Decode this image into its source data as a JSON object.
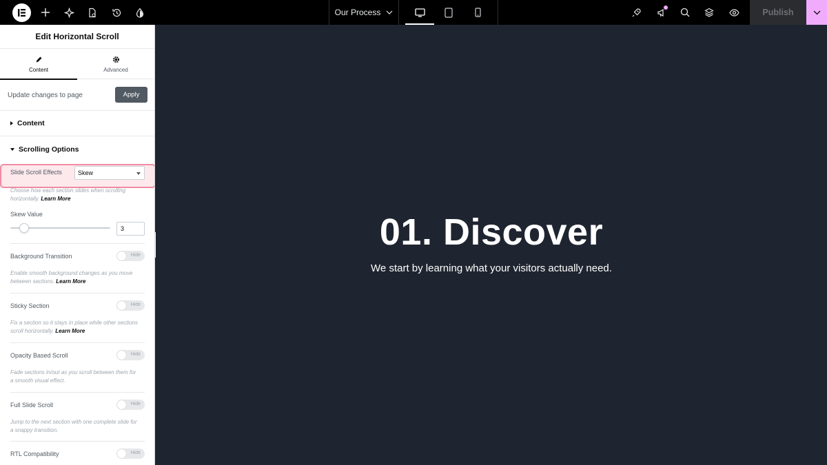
{
  "topbar": {
    "page_name": "Our Process",
    "publish_label": "Publish"
  },
  "panel": {
    "title": "Edit Horizontal Scroll",
    "tabs": [
      {
        "label": "Content",
        "icon": "pencil-icon",
        "active": true
      },
      {
        "label": "Advanced",
        "icon": "gear-icon",
        "active": false
      }
    ],
    "update_text": "Update changes to page",
    "apply_label": "Apply",
    "sections": {
      "content_label": "Content",
      "scrolling_label": "Scrolling Options"
    },
    "slide_scroll": {
      "label": "Slide Scroll Effects",
      "value": "Skew",
      "desc": "Choose how each section slides when scrolling horizontally.",
      "learn_more": "Learn More"
    },
    "skew": {
      "label": "Skew Value",
      "value": "3",
      "slider_fraction": 0.14
    },
    "toggles": [
      {
        "label": "Background Transition",
        "state": "Hide",
        "desc": "Enable smooth background changes as you move between sections.",
        "learn_more": "Learn More"
      },
      {
        "label": "Sticky Section",
        "state": "Hide",
        "desc": "Fix a section so it stays in place while other sections scroll horizontally.",
        "learn_more": "Learn More"
      },
      {
        "label": "Opacity Based Scroll",
        "state": "Hide",
        "desc": "Fade sections in/out as you scroll between them for a smooth visual effect.",
        "learn_more": ""
      },
      {
        "label": "Full Slide Scroll",
        "state": "Hide",
        "desc": "Jump to the next section with one complete slide for a snappy transition.",
        "learn_more": ""
      },
      {
        "label": "RTL Compatibility",
        "state": "Hide",
        "desc": "",
        "learn_more": ""
      }
    ]
  },
  "canvas": {
    "title": "01. Discover",
    "subtitle": "We start by learning what your visitors actually need.",
    "background": "#1f2530"
  },
  "colors": {
    "accent_pink": "#f0abfc",
    "highlight_border": "#f08aa3"
  }
}
